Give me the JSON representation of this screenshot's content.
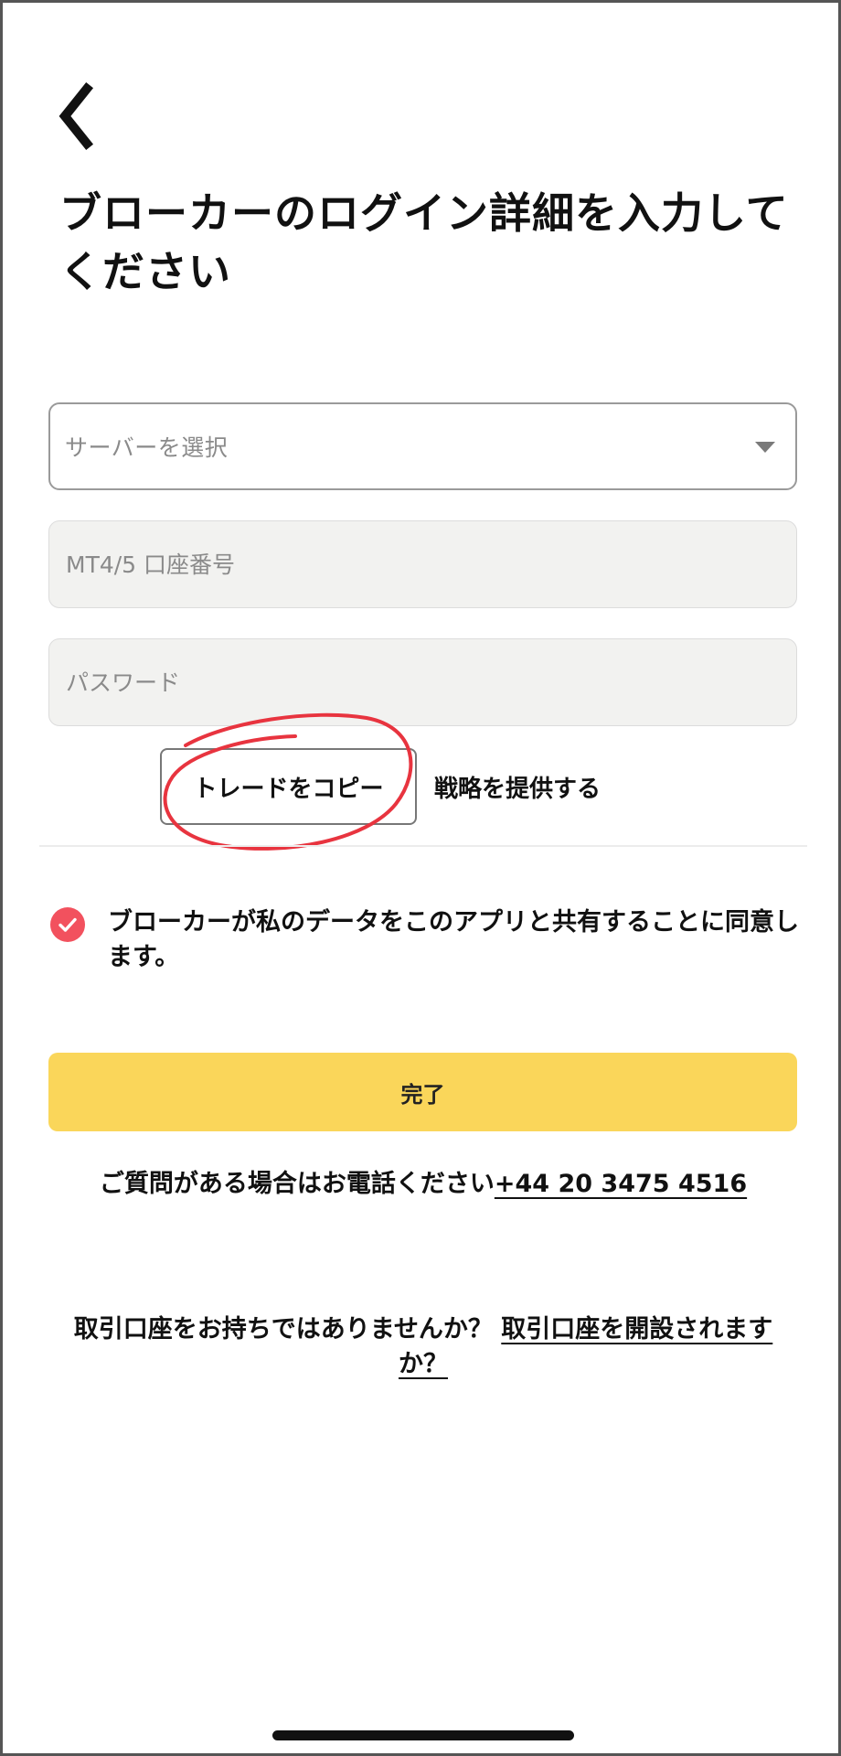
{
  "header": {
    "back_icon": "chevron-left-icon",
    "title": "ブローカーのログイン詳細を入力してください"
  },
  "form": {
    "server_select": {
      "placeholder": "サーバーを選択",
      "icon": "caret-down-icon"
    },
    "account_number": {
      "placeholder": "MT4/5 口座番号",
      "value": ""
    },
    "password": {
      "placeholder": "パスワード",
      "value": ""
    },
    "mode_toggle": {
      "options": [
        {
          "label": "トレードをコピー",
          "selected": true
        },
        {
          "label": "戦略を提供する",
          "selected": false
        }
      ],
      "highlight_color": "#e8343f"
    }
  },
  "consent": {
    "checked": true,
    "check_color": "#f2515e",
    "text": "ブローカーが私のデータをこのアプリと共有することに同意します。"
  },
  "done_button": {
    "label": "完了",
    "color": "#fad65a"
  },
  "contact": {
    "text": "ご質問がある場合はお電話ください",
    "phone": "+44 20 3475 4516"
  },
  "signup": {
    "text": "取引口座をお持ちではありませんか？ ",
    "link": "取引口座を開設されますか？"
  }
}
